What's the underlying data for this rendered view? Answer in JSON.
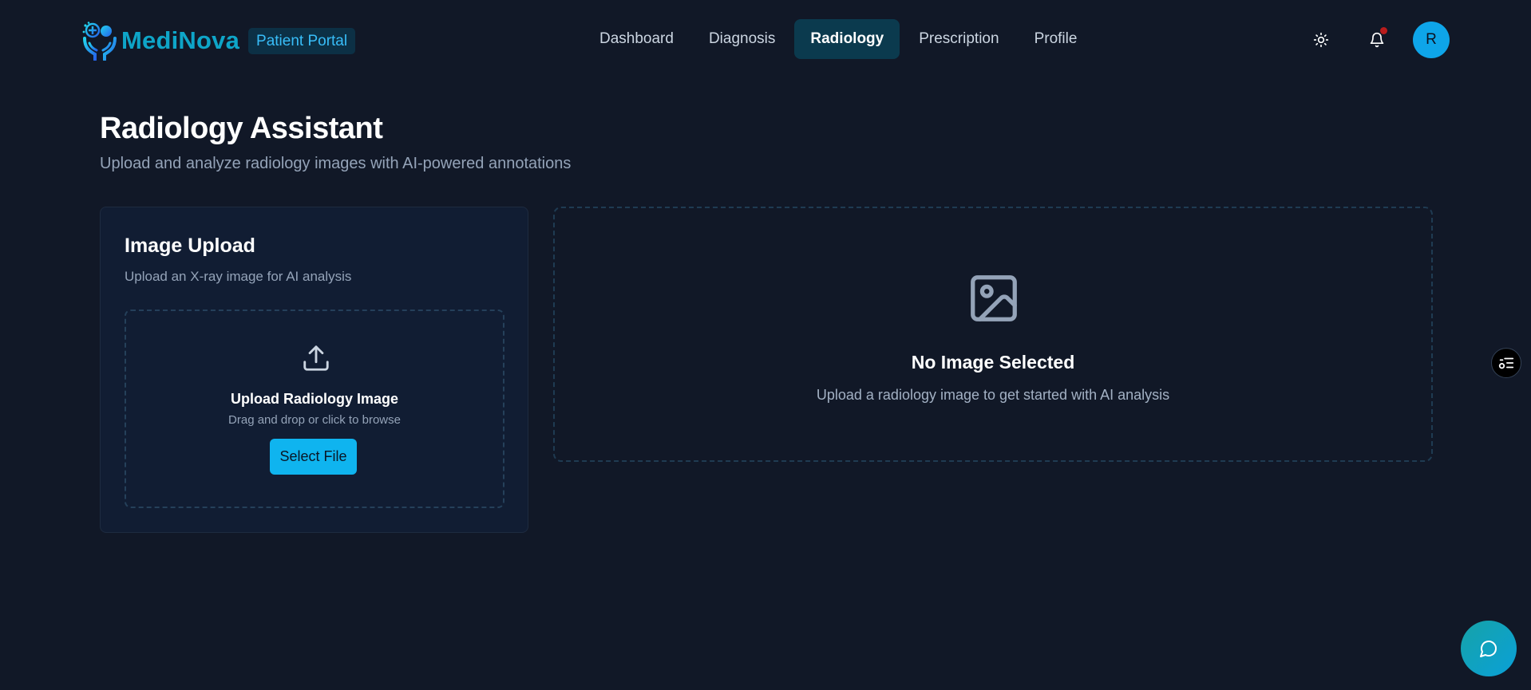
{
  "header": {
    "brand": "MediNova",
    "portal_badge": "Patient Portal",
    "nav": [
      {
        "label": "Dashboard",
        "active": false
      },
      {
        "label": "Diagnosis",
        "active": false
      },
      {
        "label": "Radiology",
        "active": true
      },
      {
        "label": "Prescription",
        "active": false
      },
      {
        "label": "Profile",
        "active": false
      }
    ],
    "avatar_initial": "R",
    "icons": {
      "logo": "medical-hands-logo-icon",
      "theme": "sun-icon",
      "notifications": "bell-icon"
    },
    "has_unread_notifications": true
  },
  "page": {
    "title": "Radiology Assistant",
    "subtitle": "Upload and analyze radiology images with AI-powered annotations"
  },
  "upload_card": {
    "title": "Image Upload",
    "subtitle": "Upload an X-ray image for AI analysis",
    "dropzone": {
      "title": "Upload Radiology Image",
      "hint": "Drag and drop or click to browse",
      "button": "Select File",
      "icon": "upload-icon"
    }
  },
  "preview": {
    "title": "No Image Selected",
    "subtitle": "Upload a radiology image to get started with AI analysis",
    "icon": "image-placeholder-icon"
  },
  "floating": {
    "side_toggle_icon": "settings-list-icon",
    "chat_icon": "chat-bubble-icon"
  },
  "colors": {
    "background": "#111827",
    "accent": "#0fb4ef",
    "brand": "#0ea5c8",
    "active_tab_bg": "#0b3a4e",
    "card_bg": "#111d33",
    "notification_dot": "#b91c1c"
  }
}
